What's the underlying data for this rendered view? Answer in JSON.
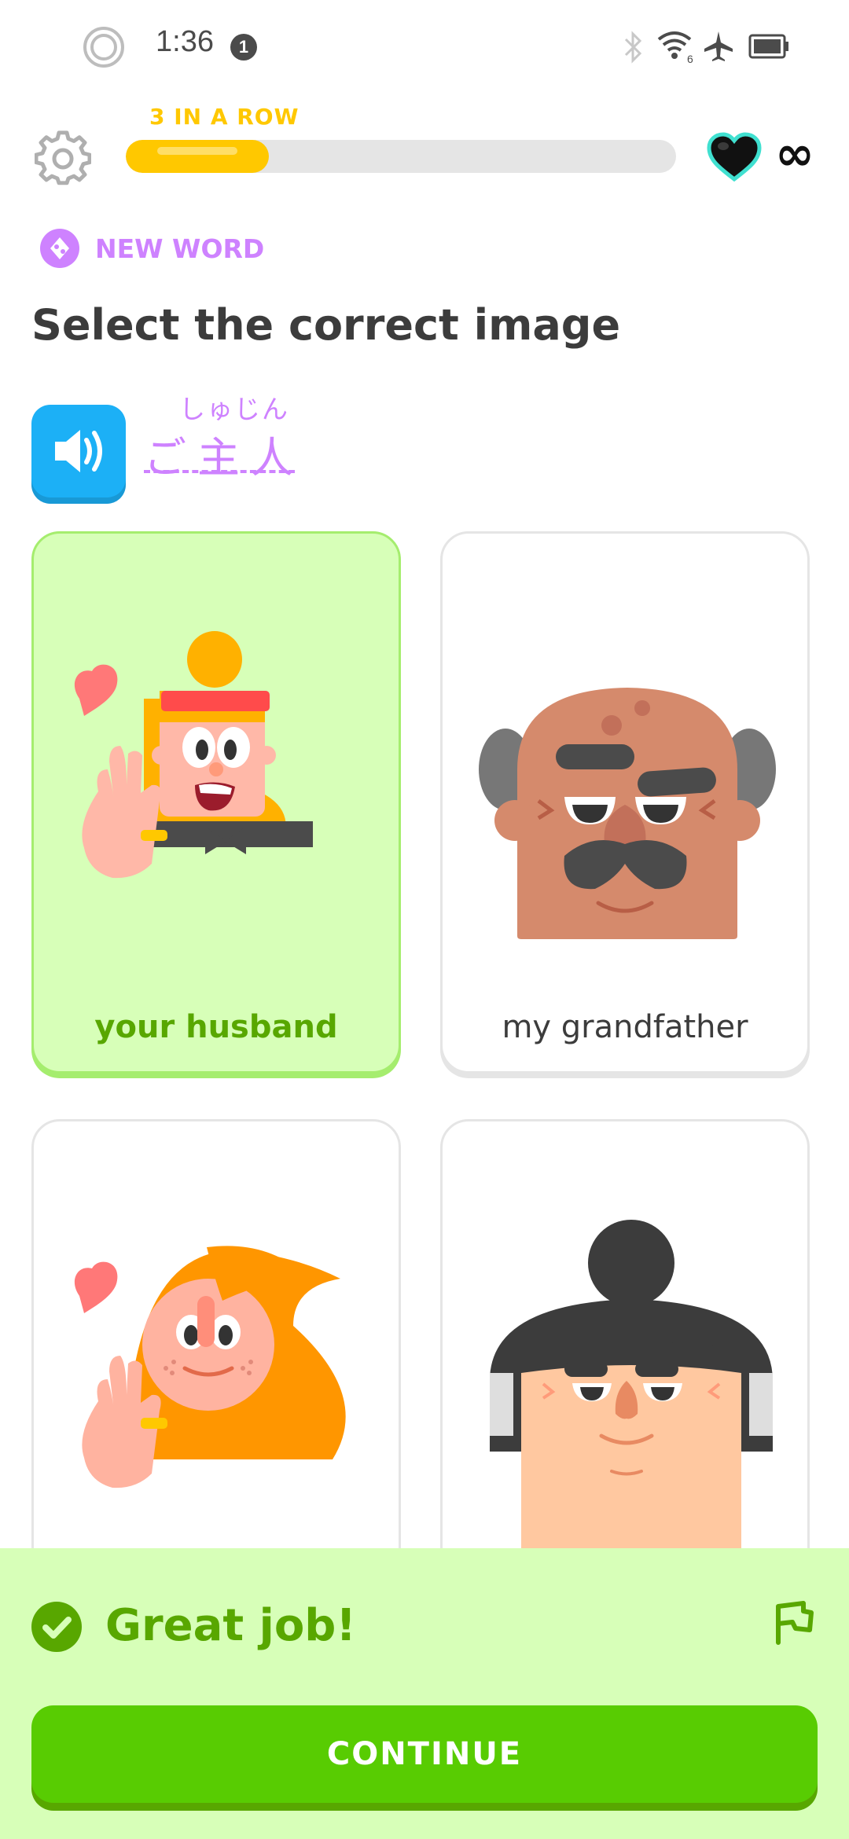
{
  "status_bar": {
    "time": "1:36",
    "notification_count": "1",
    "icons": [
      "ring-icon",
      "bluetooth-icon",
      "wifi-icon",
      "airplane-icon",
      "battery-icon"
    ]
  },
  "header": {
    "streak_label": "3 IN A ROW",
    "progress": 0.26,
    "hearts": "∞",
    "icons": [
      "gear-icon",
      "heart-icon",
      "infinity-icon"
    ]
  },
  "exercise": {
    "badge_label": "NEW WORD",
    "prompt": "Select the correct image",
    "furigana": "しゅじん",
    "word": "ご主人",
    "audio_icon": "speaker-icon"
  },
  "choices": [
    {
      "label": "your husband",
      "selected": true,
      "image": "husband-illustration"
    },
    {
      "label": "my grandfather",
      "selected": false,
      "image": "grandfather-illustration"
    },
    {
      "label": "",
      "selected": false,
      "image": "wife-illustration"
    },
    {
      "label": "",
      "selected": false,
      "image": "sumo-man-illustration"
    }
  ],
  "feedback": {
    "title": "Great job!",
    "continue_label": "CONTINUE",
    "icons": [
      "check-icon",
      "flag-icon"
    ]
  },
  "colors": {
    "accent_green": "#58cc02",
    "feedback_text": "#58a700",
    "feedback_bg": "#d7ffb8",
    "streak_gold": "#ffc800",
    "new_word_purple": "#ce82ff",
    "audio_blue": "#1cb0f6"
  }
}
